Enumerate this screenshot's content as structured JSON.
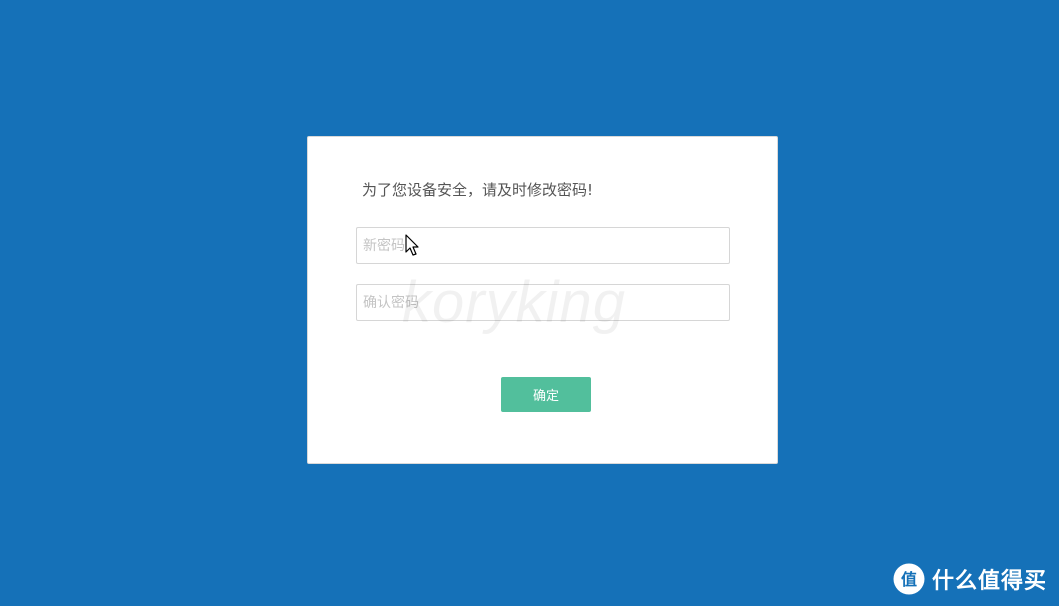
{
  "dialog": {
    "prompt": "为了您设备安全，请及时修改密码!",
    "new_password_placeholder": "新密码",
    "confirm_password_placeholder": "确认密码",
    "confirm_label": "确定"
  },
  "watermark": {
    "text": "koryking"
  },
  "brand": {
    "logo_char": "值",
    "name": "什么值得买"
  },
  "colors": {
    "background": "#1571b8",
    "dialog": "#ffffff",
    "button": "#52bf9c",
    "prompt_text": "#555555",
    "placeholder": "#c4c4c4"
  }
}
